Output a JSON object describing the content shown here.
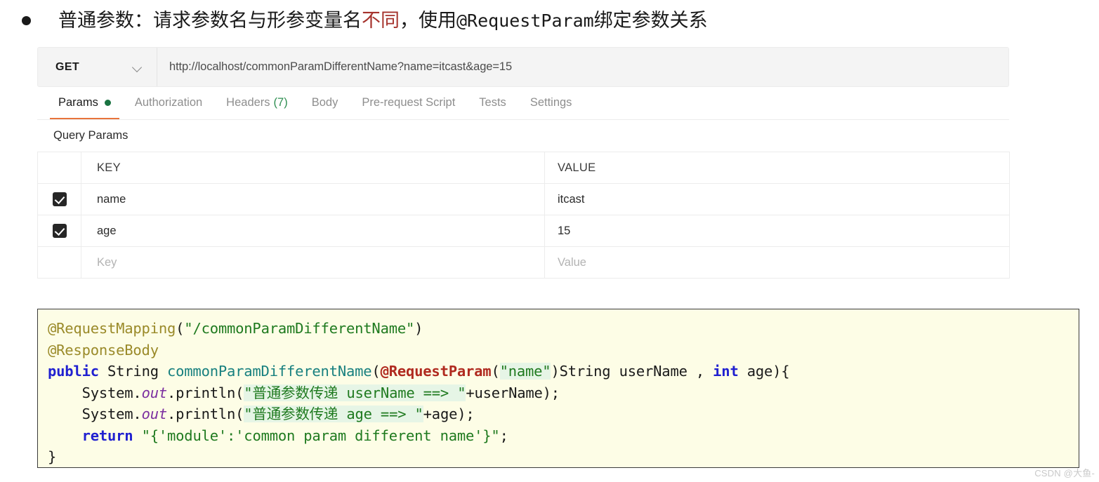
{
  "heading": {
    "bullet": "•",
    "part1": "普通参数：请求参数名与形参变量名",
    "highlight": "不同",
    "part2": "，使用",
    "mono": "@RequestParam",
    "part3": "绑定参数关系",
    "highlight_color": "#a5322c"
  },
  "postman": {
    "method": "GET",
    "url": "http://localhost/commonParamDifferentName?name=itcast&age=15",
    "tabs": [
      {
        "label": "Params",
        "active": true,
        "dot": true,
        "dot_color": "#1a7341"
      },
      {
        "label": "Authorization",
        "active": false
      },
      {
        "label": "Headers",
        "active": false,
        "count": "(7)",
        "count_color": "#2f8f52"
      },
      {
        "label": "Body",
        "active": false
      },
      {
        "label": "Pre-request Script",
        "active": false
      },
      {
        "label": "Tests",
        "active": false
      },
      {
        "label": "Settings",
        "active": false
      }
    ],
    "active_tab_underline_color": "#e8743b",
    "section_title": "Query Params",
    "table": {
      "headers": [
        "",
        "KEY",
        "VALUE"
      ],
      "rows": [
        {
          "checked": true,
          "key": "name",
          "value": "itcast",
          "placeholder": false
        },
        {
          "checked": true,
          "key": "age",
          "value": "15",
          "placeholder": false
        },
        {
          "checked": false,
          "key": "Key",
          "value": "Value",
          "placeholder": true
        }
      ]
    }
  },
  "code": {
    "lines": [
      [
        {
          "t": "@RequestMapping",
          "c": "c-ann"
        },
        {
          "t": "(",
          "c": "c-plain"
        },
        {
          "t": "\"/commonParamDifferentName\"",
          "c": "c-str"
        },
        {
          "t": ")",
          "c": "c-plain"
        }
      ],
      [
        {
          "t": "@ResponseBody",
          "c": "c-ann"
        }
      ],
      [
        {
          "t": "public",
          "c": "c-kw"
        },
        {
          "t": " String ",
          "c": "c-plain"
        },
        {
          "t": "commonParamDifferentName",
          "c": "c-fn"
        },
        {
          "t": "(",
          "c": "c-plain"
        },
        {
          "t": "@RequestParam",
          "c": "c-ann2"
        },
        {
          "t": "(",
          "c": "c-plain"
        },
        {
          "t": "\"name\"",
          "c": "c-strhl"
        },
        {
          "t": ")String userName , ",
          "c": "c-plain"
        },
        {
          "t": "int",
          "c": "c-kw"
        },
        {
          "t": " age){",
          "c": "c-plain"
        }
      ],
      [
        {
          "t": "    System.",
          "c": "c-plain"
        },
        {
          "t": "out",
          "c": "c-stat"
        },
        {
          "t": ".println(",
          "c": "c-plain"
        },
        {
          "t": "\"普通参数传递 userName ==> \"",
          "c": "c-strhl"
        },
        {
          "t": "+userName);",
          "c": "c-plain"
        }
      ],
      [
        {
          "t": "    System.",
          "c": "c-plain"
        },
        {
          "t": "out",
          "c": "c-stat"
        },
        {
          "t": ".println(",
          "c": "c-plain"
        },
        {
          "t": "\"普通参数传递 age ==> \"",
          "c": "c-strhl"
        },
        {
          "t": "+age);",
          "c": "c-plain"
        }
      ],
      [
        {
          "t": "    ",
          "c": "c-plain"
        },
        {
          "t": "return",
          "c": "c-kw"
        },
        {
          "t": " ",
          "c": "c-plain"
        },
        {
          "t": "\"{'module':'common param different name'}\"",
          "c": "c-str"
        },
        {
          "t": ";",
          "c": "c-plain"
        }
      ],
      [
        {
          "t": "}",
          "c": "c-plain"
        }
      ]
    ]
  },
  "watermark": "CSDN @大鱼-"
}
